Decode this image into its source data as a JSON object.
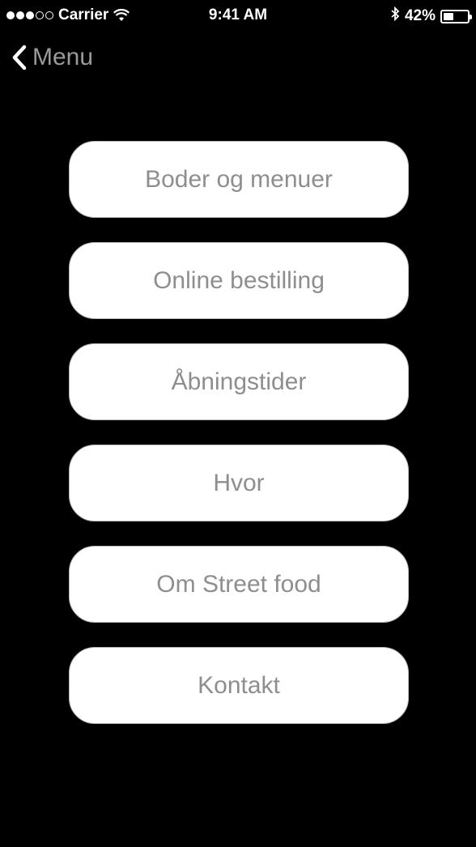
{
  "status_bar": {
    "carrier": "Carrier",
    "signal_dots_filled": 3,
    "signal_dots_total": 5,
    "time": "9:41 AM",
    "battery": "42%",
    "battery_level": 0.42,
    "icons": [
      "wifi-icon",
      "bluetooth-icon",
      "battery-icon"
    ]
  },
  "nav": {
    "back_label": "Menu",
    "back_icon": "chevron-left-icon"
  },
  "menu": {
    "items": [
      {
        "label": "Boder og menuer"
      },
      {
        "label": "Online bestilling"
      },
      {
        "label": "Åbningstider"
      },
      {
        "label": "Hvor"
      },
      {
        "label": "Om Street food"
      },
      {
        "label": "Kontakt"
      }
    ]
  },
  "colors": {
    "background": "#000000",
    "button_bg": "#ffffff",
    "button_text": "#8e8e8e",
    "nav_text": "#9a9a9a"
  }
}
